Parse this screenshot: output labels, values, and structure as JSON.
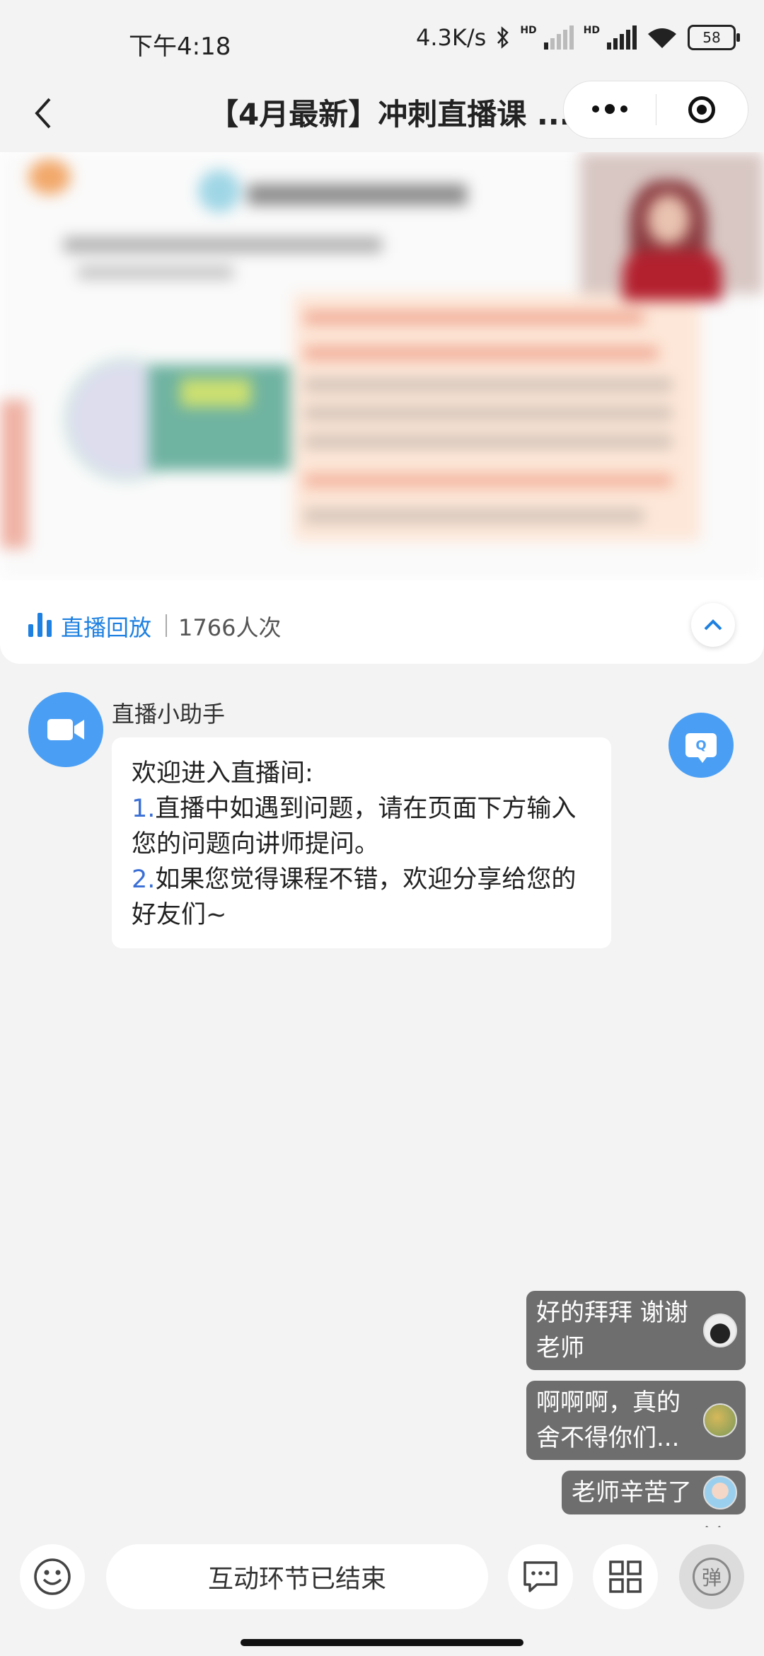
{
  "status_bar": {
    "time": "下午4:18",
    "network_speed": "4.3K/s",
    "battery": "58",
    "icons": [
      "bluetooth-icon",
      "hd-signal-icon",
      "hd-signal-icon",
      "wifi-icon",
      "battery-icon"
    ]
  },
  "nav": {
    "title": "【4月最新】冲刺直播课 ...",
    "icons": [
      "back-icon",
      "more-icon",
      "target-icon"
    ]
  },
  "video": {
    "state": "blurred-slide-with-presenter"
  },
  "info_bar": {
    "replay_label": "直播回放",
    "viewer_count": "1766人次",
    "icons": [
      "bar-chart-icon",
      "chevron-up-icon"
    ]
  },
  "assistant": {
    "name": "直播小助手",
    "icon": "video-camera-icon",
    "message": {
      "intro": "欢迎进入直播间:",
      "item1_num": "1.",
      "item1": "直播中如遇到问题，请在页面下方输入您的问题向讲师提问。",
      "item2_num": "2.",
      "item2": "如果您觉得课程不错，欢迎分享给您的好友们~"
    }
  },
  "qa_button": {
    "icon": "qa-icon",
    "label": "Q"
  },
  "comments": [
    {
      "line1": "好的拜拜 谢谢",
      "line2": "老师"
    },
    {
      "line1": "啊啊啊，真的",
      "line2": "舍不得你们..."
    },
    {
      "line1": "老师辛苦了"
    }
  ],
  "bottom_bar": {
    "input_placeholder": "互动环节已结束",
    "danmu_label": "弹",
    "icons": [
      "emoji-icon",
      "comment-icon",
      "grid-icon",
      "danmu-icon"
    ]
  },
  "colors": {
    "accent": "#1e80e0",
    "assistant_blue": "#4a9ff5",
    "background": "#f3f3f3",
    "comment_bg": "#6e6e6e"
  }
}
